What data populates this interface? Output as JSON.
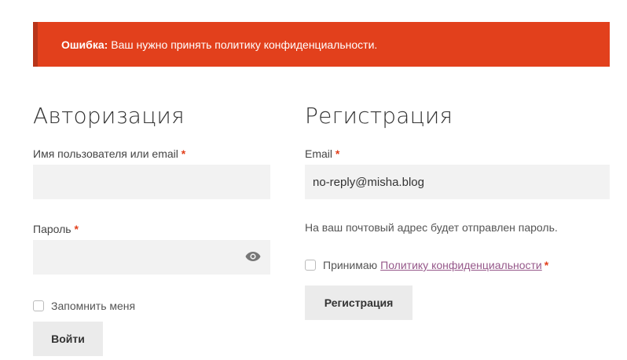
{
  "error": {
    "label": "Ошибка:",
    "message": "Ваш нужно принять политику конфиденциальности."
  },
  "login": {
    "title": "Авторизация",
    "username_label": "Имя пользователя или email",
    "username_value": "",
    "password_label": "Пароль",
    "password_value": "",
    "remember_label": "Запомнить меня",
    "submit_label": "Войти"
  },
  "register": {
    "title": "Регистрация",
    "email_label": "Email",
    "email_value": "no-reply@misha.blog",
    "note": "На ваш почтовый адрес будет отправлен пароль.",
    "accept_prefix": "Принимаю",
    "policy_link": "Политику конфиденциальности",
    "submit_label": "Регистрация"
  },
  "required_mark": "*",
  "colors": {
    "error_bg": "#e2401c",
    "required": "#e2401c",
    "link": "#96588a",
    "input_bg": "#f2f2f2",
    "button_bg": "#ebebeb"
  },
  "icons": {
    "password_toggle": "eye-icon"
  }
}
